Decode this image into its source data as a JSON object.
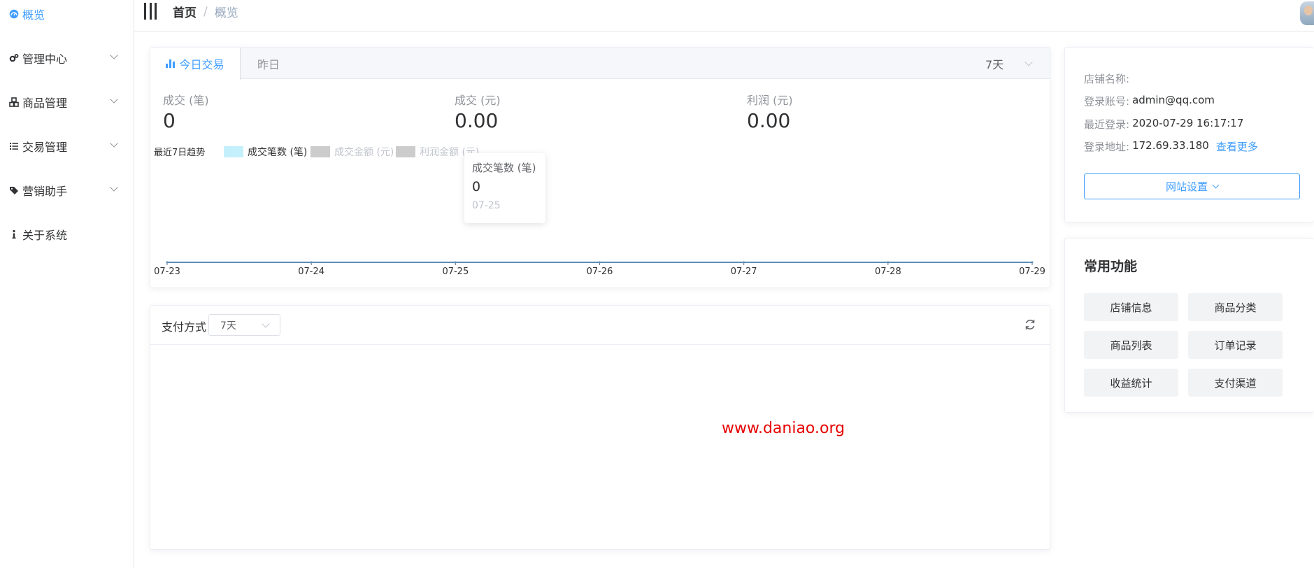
{
  "sidebar": {
    "items": [
      {
        "label": "概览",
        "icon": "dashboard-icon",
        "active": true
      },
      {
        "label": "管理中心",
        "icon": "gears-icon"
      },
      {
        "label": "商品管理",
        "icon": "cubes-icon"
      },
      {
        "label": "交易管理",
        "icon": "list-icon"
      },
      {
        "label": "营销助手",
        "icon": "tags-icon"
      },
      {
        "label": "关于系统",
        "icon": "info-icon"
      }
    ]
  },
  "header": {
    "breadcrumb": [
      "首页",
      "概览"
    ],
    "separator": "/"
  },
  "trade": {
    "tabs": [
      "今日交易",
      "昨日"
    ],
    "range": "7天",
    "stats": [
      {
        "label": "成交 (笔)",
        "value": "0"
      },
      {
        "label": "成交 (元)",
        "value": "0.00"
      },
      {
        "label": "利润 (元)",
        "value": "0.00"
      }
    ],
    "trend_title": "最近7日趋势",
    "tooltip": {
      "title": "成交笔数 (笔)",
      "value": "0",
      "date": "07-25"
    }
  },
  "chart_data": {
    "type": "line",
    "title": "最近7日趋势",
    "x": [
      "07-23",
      "07-24",
      "07-25",
      "07-26",
      "07-27",
      "07-28",
      "07-29"
    ],
    "series": [
      {
        "name": "成交笔数 (笔)",
        "values": [
          0,
          0,
          0,
          0,
          0,
          0,
          0
        ],
        "color": "#c4f0fb",
        "visible": true
      },
      {
        "name": "成交金额 (元)",
        "values": [
          0,
          0,
          0,
          0,
          0,
          0,
          0
        ],
        "color": "#cccccc",
        "visible": false
      },
      {
        "name": "利润金额 (元)",
        "values": [
          0,
          0,
          0,
          0,
          0,
          0,
          0
        ],
        "color": "#cccccc",
        "visible": false
      }
    ],
    "line_color": "#5b8fb9",
    "legend": "top-left",
    "grid": false
  },
  "payment": {
    "title": "支付方式",
    "range": "7天",
    "watermark": "www.daniao.org"
  },
  "store": {
    "rows": [
      {
        "key": "店铺名称:",
        "value": ""
      },
      {
        "key": "登录账号:",
        "value": "admin@qq.com"
      },
      {
        "key": "最近登录:",
        "value": "2020-07-29 16:17:17"
      },
      {
        "key": "登录地址:",
        "value": "172.69.33.180",
        "link": "查看更多"
      }
    ],
    "button": "网站设置"
  },
  "functions": {
    "title": "常用功能",
    "buttons": [
      "店铺信息",
      "商品分类",
      "商品列表",
      "订单记录",
      "收益统计",
      "支付渠道"
    ]
  },
  "colors": {
    "accent": "#409eff",
    "watermark": "#e60000"
  }
}
